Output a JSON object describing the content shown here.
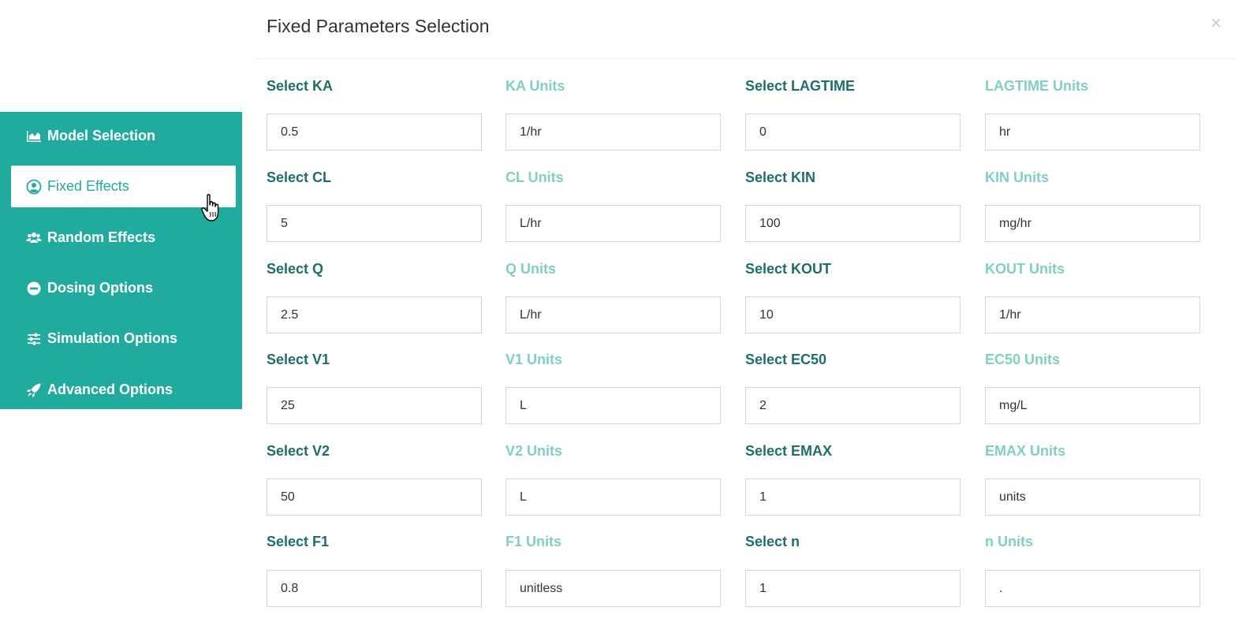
{
  "sidebar": {
    "items": [
      {
        "label": "Model Selection",
        "icon": "area-chart-icon",
        "active": false
      },
      {
        "label": "Fixed Effects",
        "icon": "user-circle-icon",
        "active": true
      },
      {
        "label": "Random Effects",
        "icon": "users-icon",
        "active": false
      },
      {
        "label": "Dosing Options",
        "icon": "minus-circle-icon",
        "active": false
      },
      {
        "label": "Simulation Options",
        "icon": "sliders-icon",
        "active": false
      },
      {
        "label": "Advanced Options",
        "icon": "rocket-icon",
        "active": false
      }
    ],
    "accent_color": "#21aa9e"
  },
  "modal": {
    "title": "Fixed Parameters Selection",
    "close_label": "×"
  },
  "fields": [
    {
      "param_label": "Select KA",
      "param_value": "0.5",
      "unit_label": "KA Units",
      "unit_value": "1/hr"
    },
    {
      "param_label": "Select LAGTIME",
      "param_value": "0",
      "unit_label": "LAGTIME Units",
      "unit_value": "hr"
    },
    {
      "param_label": "Select CL",
      "param_value": "5",
      "unit_label": "CL Units",
      "unit_value": "L/hr"
    },
    {
      "param_label": "Select KIN",
      "param_value": "100",
      "unit_label": "KIN Units",
      "unit_value": "mg/hr"
    },
    {
      "param_label": "Select Q",
      "param_value": "2.5",
      "unit_label": "Q Units",
      "unit_value": "L/hr"
    },
    {
      "param_label": "Select KOUT",
      "param_value": "10",
      "unit_label": "KOUT Units",
      "unit_value": "1/hr"
    },
    {
      "param_label": "Select V1",
      "param_value": "25",
      "unit_label": "V1 Units",
      "unit_value": "L"
    },
    {
      "param_label": "Select EC50",
      "param_value": "2",
      "unit_label": "EC50 Units",
      "unit_value": "mg/L"
    },
    {
      "param_label": "Select V2",
      "param_value": "50",
      "unit_label": "V2 Units",
      "unit_value": "L"
    },
    {
      "param_label": "Select EMAX",
      "param_value": "1",
      "unit_label": "EMAX Units",
      "unit_value": "units"
    },
    {
      "param_label": "Select F1",
      "param_value": "0.8",
      "unit_label": "F1 Units",
      "unit_value": "unitless"
    },
    {
      "param_label": "Select n",
      "param_value": "1",
      "unit_label": "n Units",
      "unit_value": "."
    }
  ]
}
